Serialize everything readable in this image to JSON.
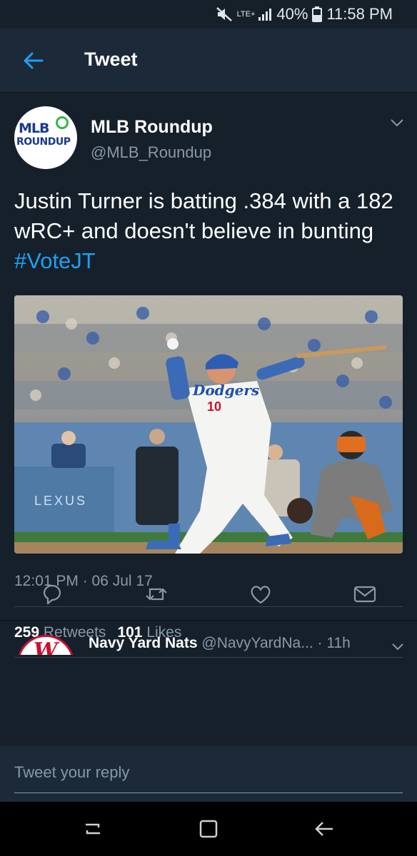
{
  "status_bar": {
    "network": "LTE+",
    "battery": "40%",
    "time": "11:58 PM"
  },
  "header": {
    "title": "Tweet",
    "back_icon": "back-arrow-icon"
  },
  "tweet": {
    "display_name": "MLB Roundup",
    "handle": "@MLB_Roundup",
    "avatar_logo_line1": "MLB",
    "avatar_logo_line2": "ROUNDUP",
    "text_main": "Justin Turner is batting .384 with a 182 wRC+ and doesn't believe in bunting ",
    "hashtag": "#VoteJT",
    "photo_jersey_team": "Dodgers",
    "photo_jersey_number": "10",
    "photo_ad_text": "LEXUS",
    "timestamp": "12:01 PM · 06 Jul 17",
    "retweets_count": "259",
    "retweets_label": "Retweets",
    "likes_count": "101",
    "likes_label": "Likes",
    "actions": [
      "reply-icon",
      "retweet-icon",
      "like-heart-icon",
      "direct-message-icon"
    ]
  },
  "reply_preview": {
    "name": "Navy Yard Nats",
    "handle": "@NavyYardNa...",
    "age": "· 11h",
    "avatar_letter": "W"
  },
  "reply_bar": {
    "placeholder": "Tweet your reply"
  },
  "nav_bar": {
    "buttons": [
      "recent-apps-icon",
      "home-icon",
      "back-icon"
    ]
  },
  "colors": {
    "background": "#15202b",
    "header": "#1c2938",
    "accent": "#1da1f2",
    "secondary_text": "#8899a6"
  }
}
